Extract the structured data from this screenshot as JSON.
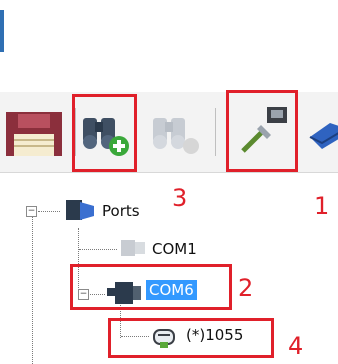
{
  "toolbar": {
    "buttons": [
      {
        "name": "save",
        "icon": "floppy-disk-icon"
      },
      {
        "name": "scan-devices",
        "icon": "binoculars-add-icon"
      },
      {
        "name": "scan-devices-disabled",
        "icon": "binoculars-icon"
      },
      {
        "name": "connect",
        "icon": "plug-connect-icon"
      },
      {
        "name": "network",
        "icon": "network-icon"
      }
    ]
  },
  "tree": {
    "root": {
      "label": "Ports",
      "expander": "−"
    },
    "com1": {
      "label": "COM1"
    },
    "com6": {
      "label": "COM6",
      "expander": "−"
    },
    "device": {
      "label": "(*)1055"
    }
  },
  "callouts": {
    "one": "1",
    "two": "2",
    "three": "3",
    "four": "4"
  },
  "colors": {
    "highlight": "#e0202a",
    "selection": "#3399ff"
  }
}
